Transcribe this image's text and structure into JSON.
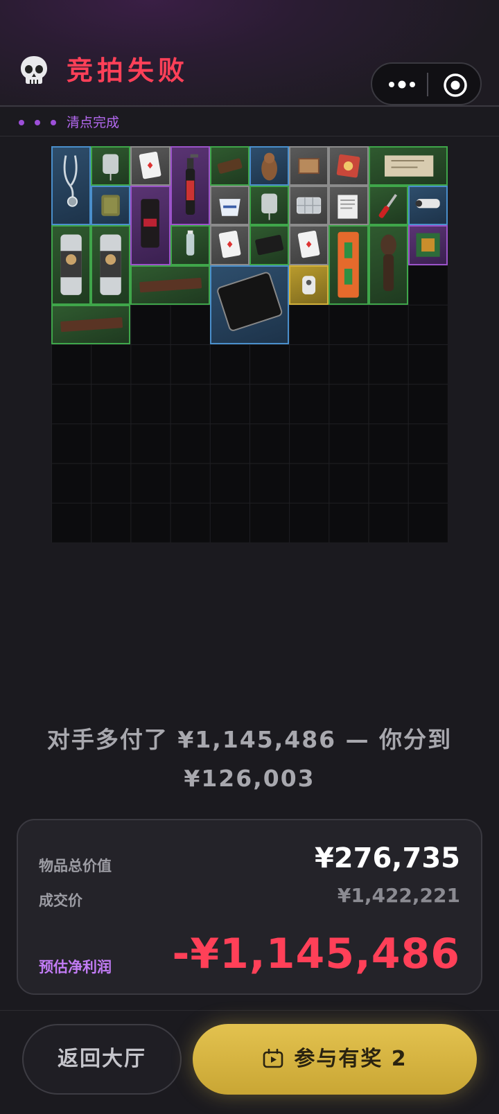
{
  "header": {
    "title": "竞拍失败",
    "status": "清点完成"
  },
  "colors": {
    "accent_red": "#ff4058",
    "accent_purple": "#b469f0",
    "accent_gold": "#d9b640"
  },
  "grid": {
    "items": [
      {
        "name": "stethoscope",
        "rarity": "blue"
      },
      {
        "name": "iv-bag",
        "rarity": "green"
      },
      {
        "name": "playing-card",
        "rarity": "gray"
      },
      {
        "name": "blowtorch",
        "rarity": "purple"
      },
      {
        "name": "chocolate-bar",
        "rarity": "green"
      },
      {
        "name": "owl-figurine",
        "rarity": "blue"
      },
      {
        "name": "matchbox",
        "rarity": "gray"
      },
      {
        "name": "snack-pack",
        "rarity": "gray"
      },
      {
        "name": "old-map",
        "rarity": "green"
      },
      {
        "name": "food-ration",
        "rarity": "blue"
      },
      {
        "name": "coffee-bag",
        "rarity": "purple"
      },
      {
        "name": "yogurt-cup",
        "rarity": "gray"
      },
      {
        "name": "iv-bag",
        "rarity": "green"
      },
      {
        "name": "pill-box",
        "rarity": "gray"
      },
      {
        "name": "documents",
        "rarity": "gray"
      },
      {
        "name": "screwdriver",
        "rarity": "green"
      },
      {
        "name": "security-camera",
        "rarity": "blue"
      },
      {
        "name": "energy-can",
        "rarity": "green"
      },
      {
        "name": "energy-can",
        "rarity": "green"
      },
      {
        "name": "water-bottle",
        "rarity": "green"
      },
      {
        "name": "playing-card",
        "rarity": "gray"
      },
      {
        "name": "card-sleeve",
        "rarity": "green"
      },
      {
        "name": "playing-card",
        "rarity": "gray"
      },
      {
        "name": "spirit-level",
        "rarity": "green"
      },
      {
        "name": "tribal-statue",
        "rarity": "green"
      },
      {
        "name": "circuit-board",
        "rarity": "purple"
      },
      {
        "name": "wood-plank",
        "rarity": "green"
      },
      {
        "name": "tablet",
        "rarity": "blue"
      },
      {
        "name": "gadget",
        "rarity": "gold"
      },
      {
        "name": "wood-plank",
        "rarity": "green"
      }
    ]
  },
  "result": {
    "message": "对手多付了 ¥1,145,486 — 你分到 ¥126,003"
  },
  "summary": {
    "total_value_label": "物品总价值",
    "total_value": "¥276,735",
    "deal_price_label": "成交价",
    "deal_price": "¥1,422,221",
    "net_profit_label": "预估净利润",
    "net_profit": "-¥1,145,486"
  },
  "buttons": {
    "lobby": "返回大厅",
    "reward": "参与有奖 2",
    "reward_icon": "video-icon"
  }
}
